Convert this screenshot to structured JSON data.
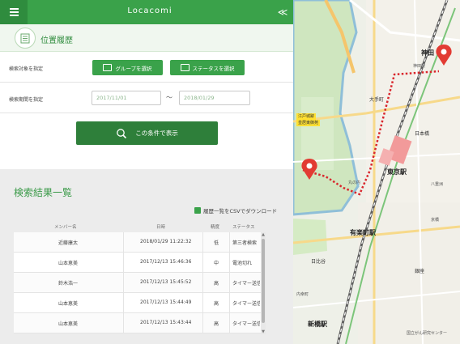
{
  "header": {
    "app_title": "Locacomi",
    "collapse_glyph": "≪",
    "menu_icon": "hamburger-menu-icon"
  },
  "page": {
    "title": "位置履歴",
    "icon": "history-list-icon"
  },
  "filters": {
    "target_label": "検索対象を指定",
    "group_button": "グループを選択",
    "status_button": "ステータスを選択",
    "period_label": "検索期間を指定",
    "date_from": "2017/11/01",
    "date_to": "2018/01/29",
    "tilde": "〜"
  },
  "search_button": "この条件で表示",
  "results": {
    "title": "検索結果一覧",
    "csv_link": "履歴一覧をCSVでダウンロード",
    "columns": [
      "メンバー名",
      "日時",
      "精度",
      "ステータス"
    ],
    "rows": [
      {
        "name": "近藤康太",
        "datetime": "2018/01/29 11:22:32",
        "accuracy": "低",
        "status": "第三者検索"
      },
      {
        "name": "山本恵美",
        "datetime": "2017/12/13 15:46:36",
        "accuracy": "中",
        "status": "電池切れ"
      },
      {
        "name": "鈴木浩一",
        "datetime": "2017/12/13 15:45:52",
        "accuracy": "高",
        "status": "タイマー送信"
      },
      {
        "name": "山本恵美",
        "datetime": "2017/12/13 15:44:49",
        "accuracy": "高",
        "status": "タイマー送信"
      },
      {
        "name": "山本恵美",
        "datetime": "2017/12/13 15:43:44",
        "accuracy": "高",
        "status": "タイマー送信"
      }
    ]
  },
  "map": {
    "labels": {
      "kanda": "神田",
      "tokyo_station": "東京駅",
      "yurakucho": "有楽町駅",
      "shinbashi": "新橋駅",
      "otemachi": "大手町",
      "nihonbashi": "日本橋",
      "ginza": "銀座",
      "hibiya": "日比谷",
      "kanda_station": "神田駅",
      "edo_castle": "江戸城跡",
      "imperial": "皇居東御苑",
      "marunouchi": "丸の内",
      "yaesu": "八重洲",
      "kyobashi": "京橋",
      "uchisaiwaicho": "内幸町",
      "kyodai": "国立がん研究センター"
    },
    "route_color": "#d9262c",
    "pin_color": "#e23b33"
  }
}
